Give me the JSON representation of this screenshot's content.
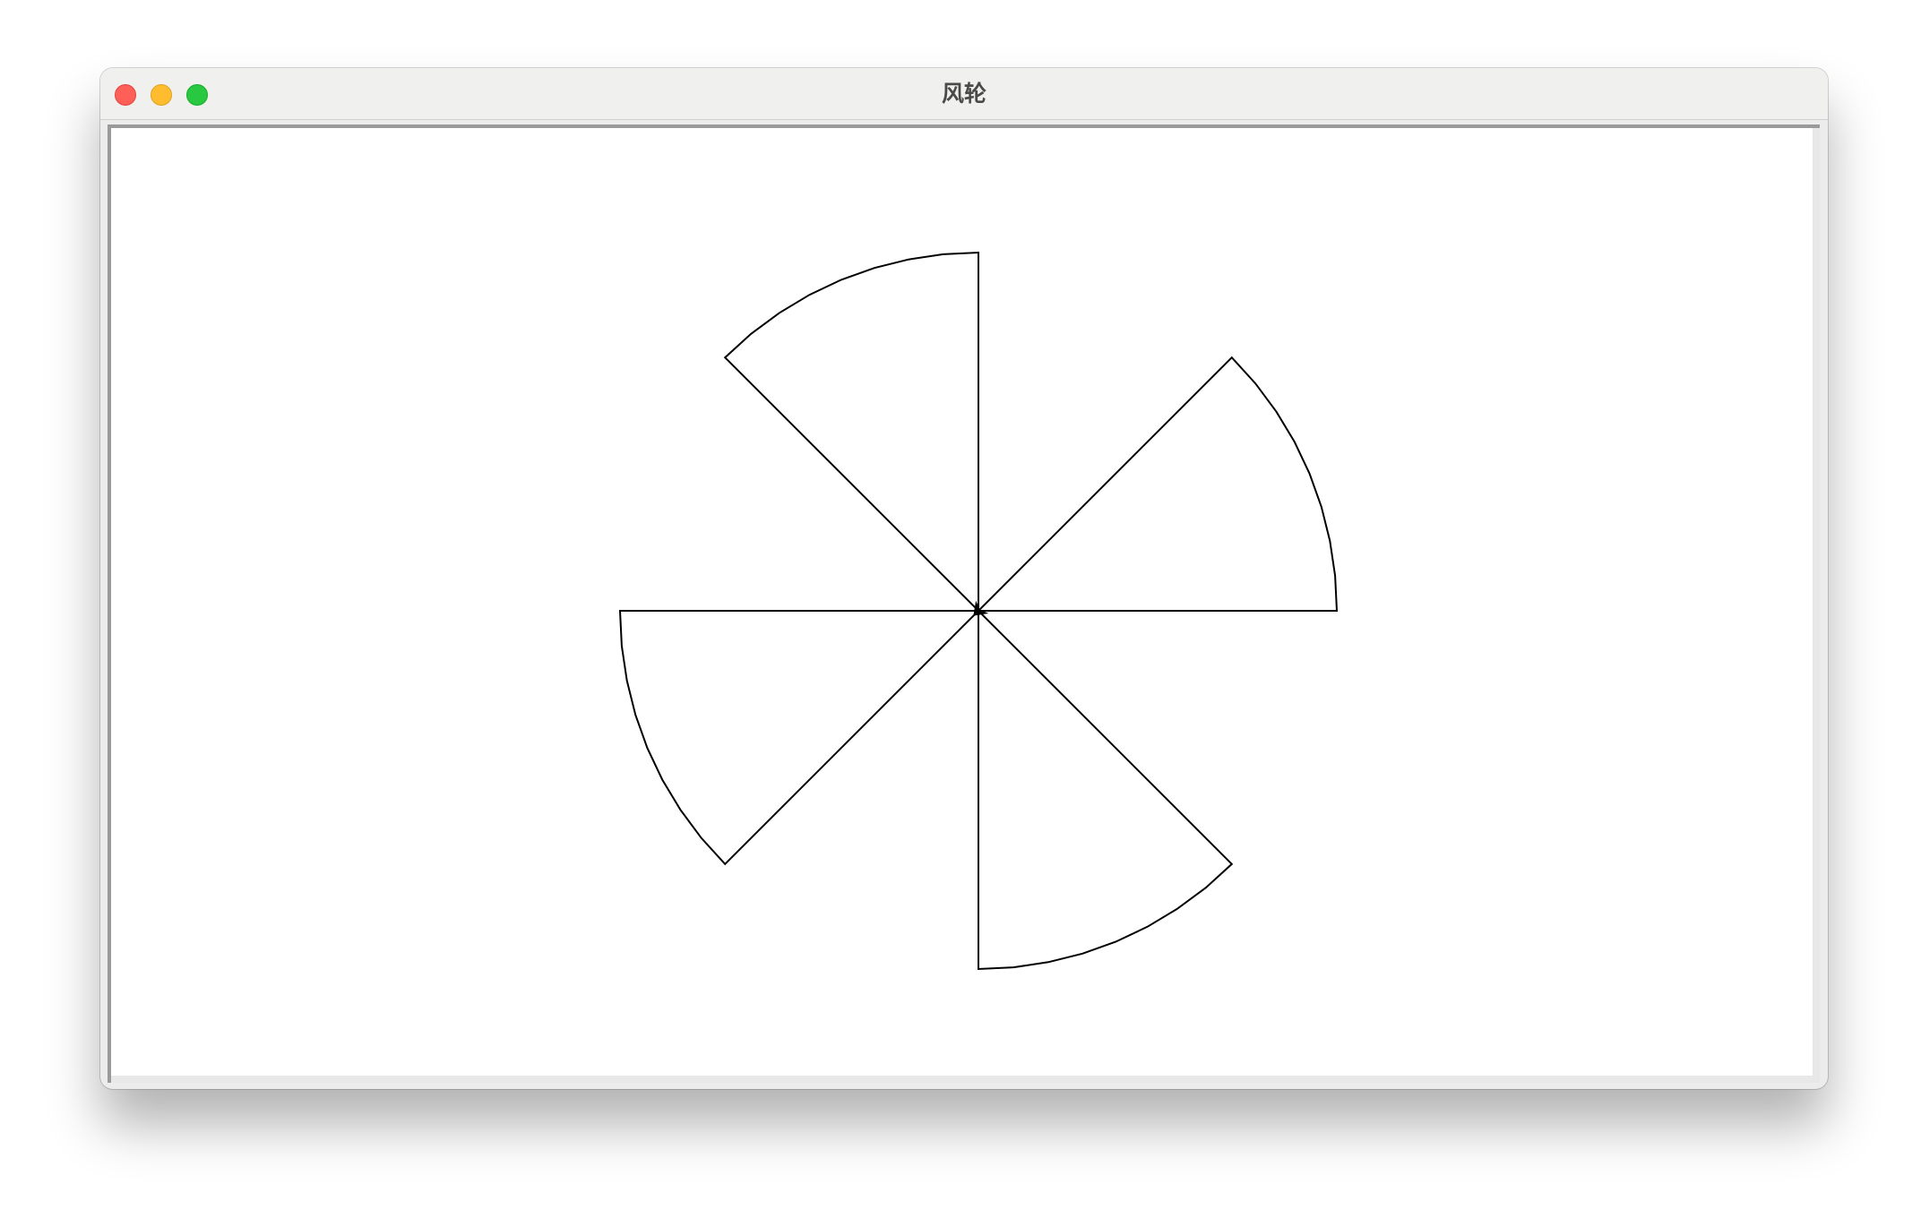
{
  "window": {
    "title": "风轮",
    "buttons": [
      "close",
      "minimize",
      "zoom"
    ]
  },
  "canvas": {
    "background": "#ffffff",
    "stroke_color": "#000000",
    "drawing": {
      "shape": "pinwheel",
      "blade_count": 4,
      "blade_angle_degrees": 45,
      "cursor": "turtle-arrow-icon"
    }
  }
}
